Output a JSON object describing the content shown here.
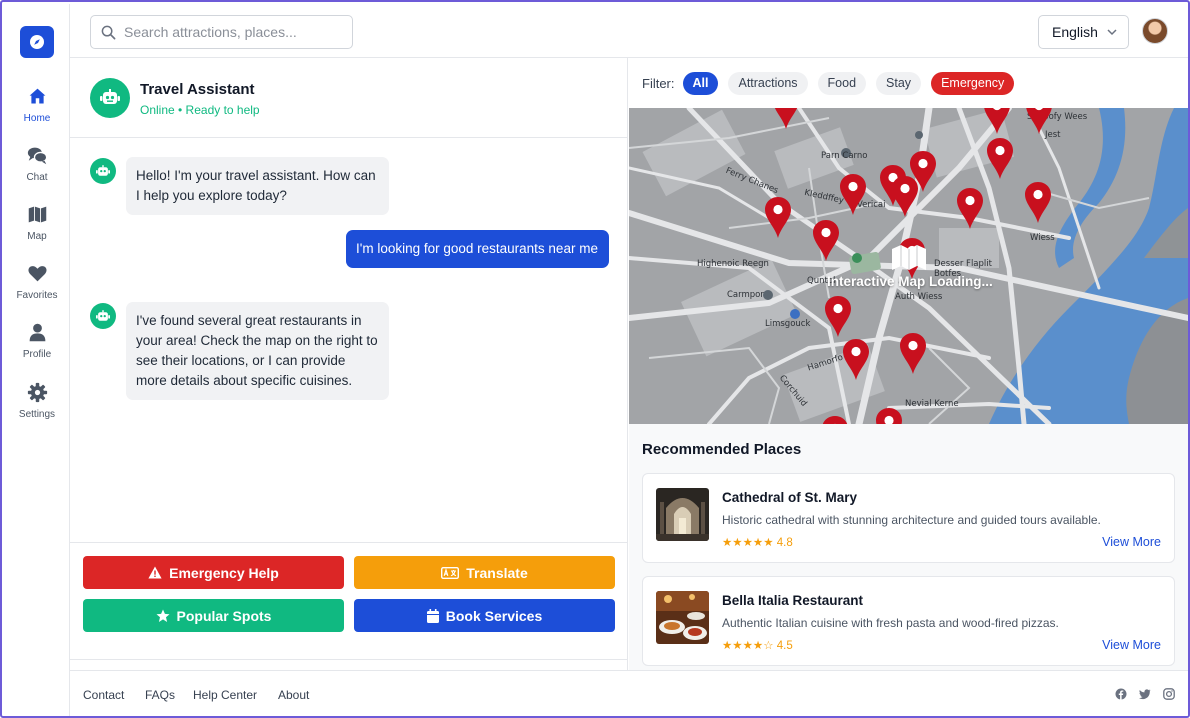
{
  "search": {
    "placeholder": "Search attractions, places..."
  },
  "header": {
    "language": "English"
  },
  "sidebar": {
    "items": [
      {
        "label": "Home",
        "icon": "home-icon",
        "active": true
      },
      {
        "label": "Chat",
        "icon": "chat-icon"
      },
      {
        "label": "Map",
        "icon": "map-icon"
      },
      {
        "label": "Favorites",
        "icon": "heart-icon"
      },
      {
        "label": "Profile",
        "icon": "user-icon"
      },
      {
        "label": "Settings",
        "icon": "gear-icon"
      }
    ]
  },
  "chat": {
    "title": "Travel Assistant",
    "status": "Online • Ready to help",
    "messages": [
      {
        "from": "bot",
        "text": "Hello! I'm your travel assistant. How can I help you explore today?"
      },
      {
        "from": "user",
        "text": "I'm looking for good restaurants near me"
      },
      {
        "from": "bot",
        "text": "I've found several great restaurants in your area! Check the map on the right to see their locations, or I can provide more details about specific cuisines."
      }
    ]
  },
  "actions": {
    "emergency": "Emergency Help",
    "translate": "Translate",
    "popular": "Popular Spots",
    "book": "Book Services"
  },
  "filter": {
    "label": "Filter:",
    "chips": [
      "All",
      "Attractions",
      "Food",
      "Stay",
      "Emergency"
    ],
    "active": "All"
  },
  "map": {
    "caption": "Interactive Map Loading...",
    "labels": [
      "Sunbofy Wees",
      "Jest",
      "Parn Carno",
      "Ferry Chanes",
      "Kleddffey",
      "Vericai",
      "Highenoic Reegn",
      "Quntol",
      "Desser Flaplit",
      "Botfes",
      "Auth Wiess",
      "Carmpor",
      "Limsgouck",
      "Hamorfo",
      "Wiess",
      "Nevial Kerne",
      "Corchuid"
    ]
  },
  "recommended": {
    "title": "Recommended Places",
    "places": [
      {
        "name": "Cathedral of St. Mary",
        "desc": "Historic cathedral with stunning architecture and guided tours available.",
        "stars": "★★★★★",
        "rating": "4.8",
        "more": "View More"
      },
      {
        "name": "Bella Italia Restaurant",
        "desc": "Authentic Italian cuisine with fresh pasta and wood-fired pizzas.",
        "stars": "★★★★☆",
        "rating": "4.5",
        "more": "View More"
      }
    ]
  },
  "footer": {
    "links": [
      "Contact",
      "FAQs",
      "Help Center",
      "About"
    ]
  },
  "colors": {
    "accent": "#1d4ed8",
    "success": "#10b981",
    "danger": "#dc2626",
    "warning": "#f59e0b",
    "pin": "#c8101e"
  }
}
